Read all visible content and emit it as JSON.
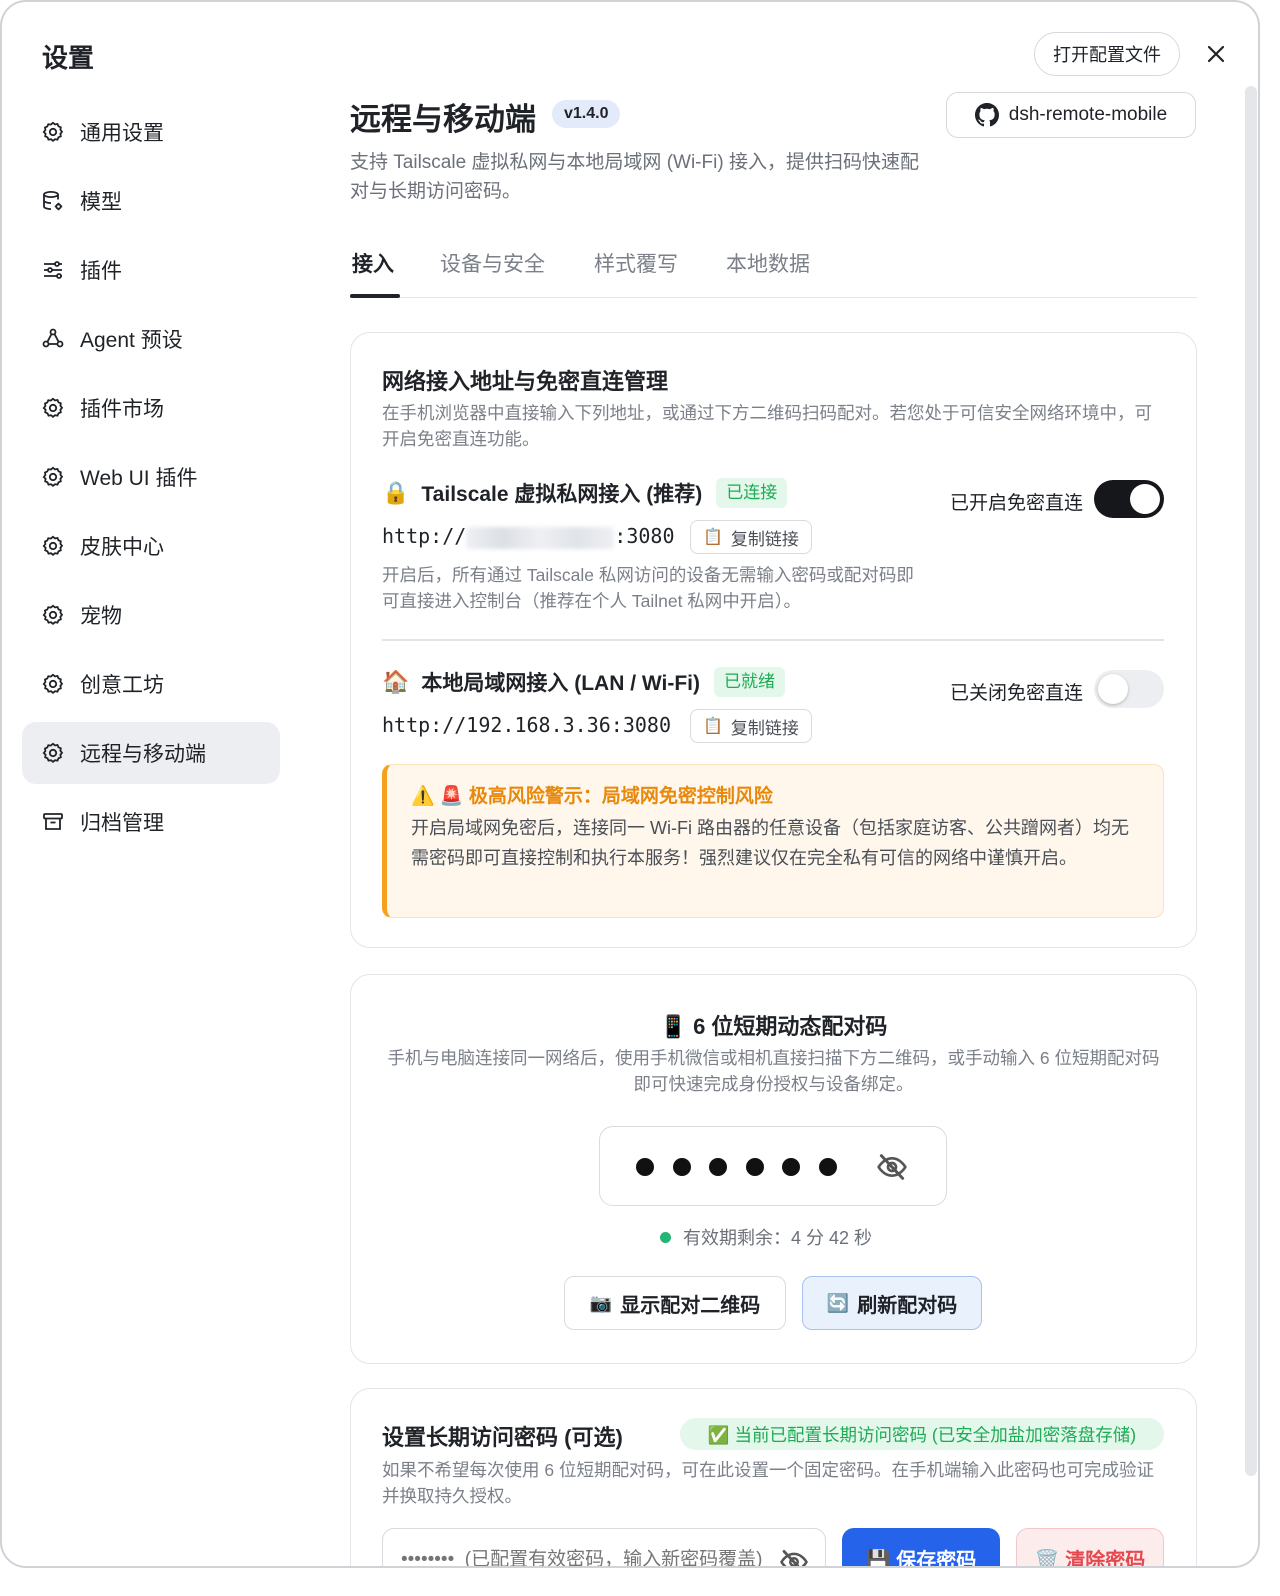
{
  "sidebar": {
    "title": "设置",
    "items": [
      {
        "label": "通用设置",
        "icon": "gear-icon"
      },
      {
        "label": "模型",
        "icon": "database-gear-icon"
      },
      {
        "label": "插件",
        "icon": "sliders-icon"
      },
      {
        "label": "Agent 预设",
        "icon": "agent-icon"
      },
      {
        "label": "插件市场",
        "icon": "gear-icon"
      },
      {
        "label": "Web UI 插件",
        "icon": "gear-icon"
      },
      {
        "label": "皮肤中心",
        "icon": "gear-icon"
      },
      {
        "label": "宠物",
        "icon": "gear-icon"
      },
      {
        "label": "创意工坊",
        "icon": "gear-icon"
      },
      {
        "label": "远程与移动端",
        "icon": "gear-icon",
        "active": true
      },
      {
        "label": "归档管理",
        "icon": "archive-icon"
      }
    ]
  },
  "header": {
    "open_config_label": "打开配置文件",
    "close_icon": "close-icon",
    "title": "远程与移动端",
    "version": "v1.4.0",
    "github_label": "dsh-remote-mobile",
    "subtitle": "支持 Tailscale 虚拟私网与本地局域网 (Wi-Fi) 接入，提供扫码快速配对与长期访问密码。"
  },
  "tabs": [
    "接入",
    "设备与安全",
    "样式覆写",
    "本地数据"
  ],
  "network": {
    "title": "网络接入地址与免密直连管理",
    "desc": "在手机浏览器中直接输入下列地址，或通过下方二维码扫码配对。若您处于可信安全网络环境中，可开启免密直连功能。",
    "tailscale": {
      "emoji": "🔒",
      "title": "Tailscale 虚拟私网接入 (推荐)",
      "badge": "已连接",
      "url_prefix": "http://",
      "url_suffix": ":3080",
      "copy_label": "复制链接",
      "toggle_label": "已开启免密直连",
      "toggle_on": true,
      "note": "开启后，所有通过 Tailscale 私网访问的设备无需输入密码或配对码即可直接进入控制台（推荐在个人 Tailnet 私网中开启）。"
    },
    "lan": {
      "emoji": "🏠",
      "title": "本地局域网接入 (LAN / Wi-Fi)",
      "badge": "已就绪",
      "url": "http://192.168.3.36:3080",
      "copy_label": "复制链接",
      "toggle_label": "已关闭免密直连",
      "toggle_on": false
    },
    "warning": {
      "title": "⚠️ 🚨 极高风险警示：局域网免密控制风险",
      "body": "开启局域网免密后，连接同一 Wi-Fi 路由器的任意设备（包括家庭访客、公共蹭网者）均无需密码即可直接控制和执行本服务！强烈建议仅在完全私有可信的网络中谨慎开启。"
    }
  },
  "pairing": {
    "title": "📱 6 位短期动态配对码",
    "desc": "手机与电脑连接同一网络后，使用手机微信或相机直接扫描下方二维码，或手动输入 6 位短期配对码即可快速完成身份授权与设备绑定。",
    "validity": "有效期剩余：4 分 42 秒",
    "show_qr_label": "显示配对二维码",
    "show_qr_emoji": "📷",
    "refresh_label": "刷新配对码",
    "refresh_emoji": "🔄"
  },
  "password": {
    "title": "设置长期访问密码 (可选)",
    "status": "✅ 当前已配置长期访问密码 (已安全加盐加密落盘存储)",
    "desc": "如果不希望每次使用 6 位短期配对码，可在此设置一个固定密码。在手机端输入此密码也可完成验证并换取持久授权。",
    "placeholder": "••••••••  (已配置有效密码，输入新密码覆盖)",
    "save_label": "💾 保存密码",
    "clear_label": "🗑️ 清除密码"
  },
  "colors": {
    "accent_blue": "#2563eb",
    "success_green": "#1eab55",
    "warning_orange": "#e8890c",
    "danger_red": "#e5484d"
  }
}
